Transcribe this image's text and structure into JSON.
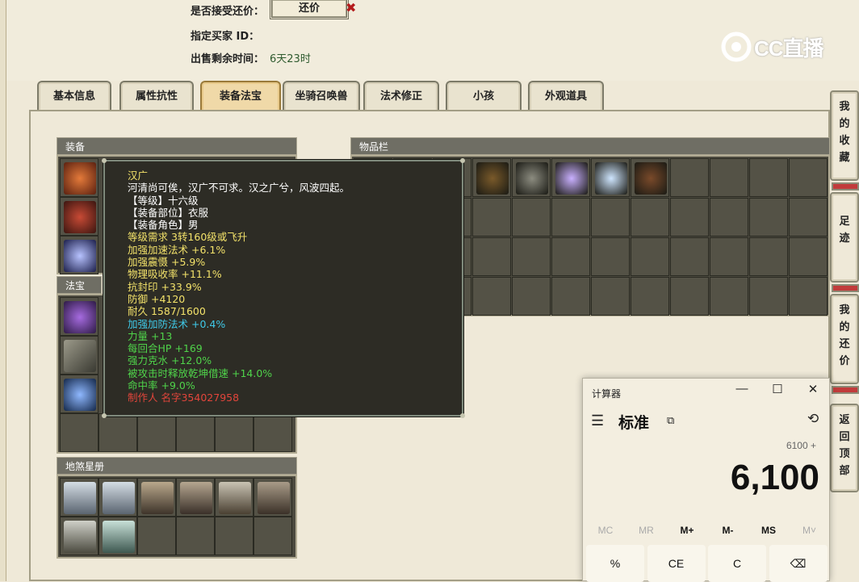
{
  "listing": {
    "accept_haggle_label": "是否接受还价：",
    "haggle_button": "还价",
    "buyer_id_label": "指定买家 ID：",
    "remaining_time_label": "出售剩余时间：",
    "remaining_time_value": "6天23时"
  },
  "logo": {
    "text": "CC直播"
  },
  "tabs": [
    "基本信息",
    "属性抗性",
    "装备法宝",
    "坐骑召唤兽",
    "法术修正",
    "小孩",
    "外观道具"
  ],
  "active_tab": 2,
  "sections": {
    "equipment": "装备",
    "inventory": "物品栏",
    "treasure": "法宝",
    "star_book": "地煞星册"
  },
  "tooltip": {
    "name": "汉广",
    "lines": [
      {
        "text": "河清尚可俟，汉广不可求。汉之广兮，风波四起。",
        "color": "#ffffff"
      },
      {
        "text": "【等级】十六级",
        "color": "#ffffff"
      },
      {
        "text": "【装备部位】衣服",
        "color": "#ffffff"
      },
      {
        "text": "【装备角色】男",
        "color": "#ffffff"
      },
      {
        "text": "等级需求 3转160级或飞升",
        "color": "#f3e26a"
      },
      {
        "text": "加强加速法术 +6.1%",
        "color": "#f3e26a"
      },
      {
        "text": "加强震慑 +5.9%",
        "color": "#f3e26a"
      },
      {
        "text": "物理吸收率 +11.1%",
        "color": "#f3e26a"
      },
      {
        "text": "抗封印 +33.9%",
        "color": "#f3e26a"
      },
      {
        "text": "防御 +4120",
        "color": "#f3e26a"
      },
      {
        "text": "耐久 1587/1600",
        "color": "#f3e26a"
      },
      {
        "text": "加强加防法术 +0.4%",
        "color": "#3fc9e8"
      },
      {
        "text": "力量 +13",
        "color": "#4fd34a"
      },
      {
        "text": "每回合HP +169",
        "color": "#4fd34a"
      },
      {
        "text": "强力克水 +12.0%",
        "color": "#4fd34a"
      },
      {
        "text": "被攻击时释放乾坤借速 +14.0%",
        "color": "#4fd34a"
      },
      {
        "text": "命中率 +9.0%",
        "color": "#4fd34a"
      },
      {
        "text": "制作人 名字354027958",
        "color": "#e2453b"
      }
    ]
  },
  "sidebar": [
    "我的收藏",
    "足迹",
    "我的还价",
    "返回顶部"
  ],
  "calculator": {
    "title": "计算器",
    "mode": "标准",
    "expression": "6100 +",
    "display": "6,100",
    "memory": [
      "MC",
      "MR",
      "M+",
      "M-",
      "MS",
      "M˅"
    ],
    "keys": [
      "%",
      "CE",
      "C",
      "⌫"
    ]
  }
}
